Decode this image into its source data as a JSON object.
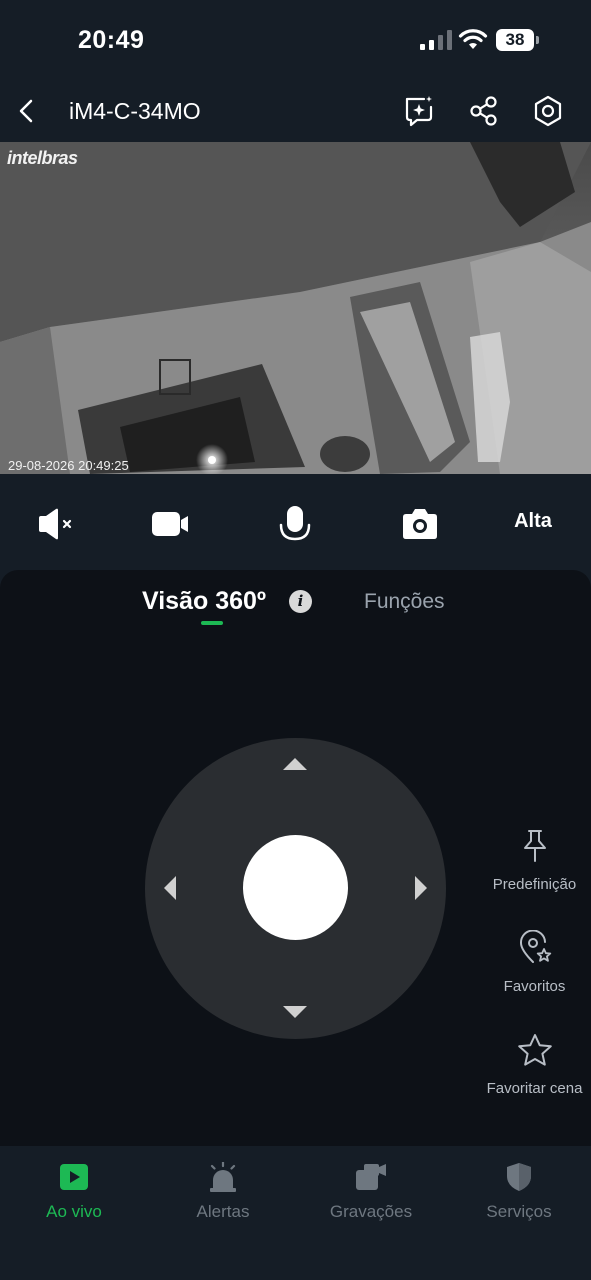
{
  "status_bar": {
    "time": "20:49",
    "battery": "38"
  },
  "header": {
    "title": "iM4-C-34MO"
  },
  "video": {
    "brand": "intelbras",
    "timestamp": "29-08-2026 20:49:25"
  },
  "controls": {
    "quality": "Alta"
  },
  "tabs": {
    "vision": "Visão 360º",
    "info": "i",
    "functions": "Funções"
  },
  "side_actions": [
    {
      "label": "Predefinição",
      "icon": "pin-icon"
    },
    {
      "label": "Favoritos",
      "icon": "location-star-icon"
    },
    {
      "label": "Favoritar cena",
      "icon": "star-icon"
    }
  ],
  "bottom_nav": [
    {
      "label": "Ao vivo",
      "icon": "live-play-icon",
      "active": true
    },
    {
      "label": "Alertas",
      "icon": "siren-icon",
      "active": false
    },
    {
      "label": "Gravações",
      "icon": "recordings-icon",
      "active": false
    },
    {
      "label": "Serviços",
      "icon": "shield-icon",
      "active": false
    }
  ],
  "colors": {
    "accent": "#1db954",
    "background": "#151d26",
    "panel": "#0d1117",
    "joystick": "#2a2d31"
  }
}
